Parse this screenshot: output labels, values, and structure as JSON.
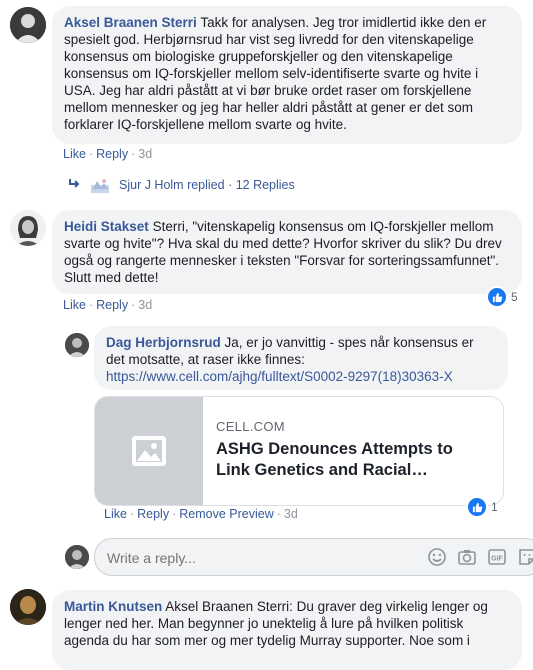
{
  "comments": [
    {
      "author": "Aksel Braanen Sterri",
      "text": "Takk for analysen. Jeg tror imidlertid ikke den er spesielt god. Herbjørnsrud har vist seg livredd for den vitenskapelige konsensus om biologiske gruppeforskjeller og den vitenskapelige konsensus om IQ-forskjeller mellom selv-identifiserte svarte og hvite i USA. Jeg har aldri påstått at vi bør bruke ordet raser om forskjellene mellom mennesker og jeg har heller aldri påstått at gener er det som forklarer IQ-forskjellene mellom svarte og hvite.",
      "like": "Like",
      "reply": "Reply",
      "time": "3d",
      "replies_summary": "Sjur J Holm replied · 12 Replies"
    },
    {
      "author": "Heidi Stakset",
      "text": "Sterri, \"vitenskapelig konsensus om IQ-forskjeller mellom svarte og hvite\"? Hva skal du med dette? Hvorfor skriver du slik? Du drev også og rangerte mennesker i teksten \"Forsvar for sorteringssamfunnet\". Slutt med dette!",
      "like": "Like",
      "reply": "Reply",
      "time": "3d",
      "reaction_count": "5"
    },
    {
      "author": "Dag Herbjornsrud",
      "text": "Ja, er jo vanvittig - spes når konsensus er det motsatte, at raser ikke finnes:",
      "url": "https://www.cell.com/ajhg/fulltext/S0002-9297(18)30363-X",
      "preview": {
        "domain": "CELL.COM",
        "title": "ASHG Denounces Attempts to Link Genetics and Racial…"
      },
      "like": "Like",
      "reply": "Reply",
      "remove_preview": "Remove Preview",
      "time": "3d",
      "reaction_count": "1"
    },
    {
      "author": "Martin Knutsen",
      "text": "Aksel Braanen Sterri: Du graver deg virkelig lenger og lenger ned her. Man begynner jo unektelig å lure på hvilken politisk agenda du har som mer og mer tydelig Murray supporter. Noe som i"
    }
  ],
  "composer": {
    "placeholder": "Write a reply..."
  },
  "icons": {
    "reply_arrow": "reply-arrow-icon",
    "emoji": "emoji-icon",
    "camera": "camera-icon",
    "gif": "gif-icon",
    "sticker": "sticker-icon",
    "image_placeholder": "image-placeholder-icon",
    "like": "thumbs-up-icon"
  },
  "colors": {
    "link": "#385898",
    "bubble": "#f2f3f5",
    "like_blue": "#1877f2",
    "meta_gray": "#90949c"
  }
}
